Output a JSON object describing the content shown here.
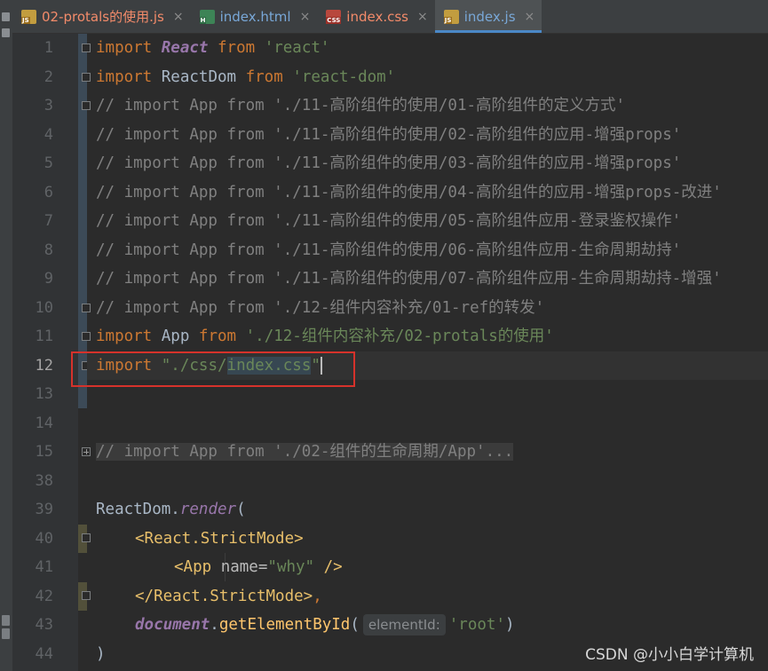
{
  "tabs": [
    {
      "label": "02-protals的使用.js",
      "icon": "js-file-icon",
      "state": "error"
    },
    {
      "label": "index.html",
      "icon": "html-file-icon",
      "state": "normal"
    },
    {
      "label": "index.css",
      "icon": "css-file-icon",
      "state": "error"
    },
    {
      "label": "index.js",
      "icon": "js-file-icon",
      "state": "active"
    }
  ],
  "tab_close_glyph": "×",
  "file_badges": {
    "js": "JS",
    "html": "H",
    "css": "CSS"
  },
  "line_numbers": [
    "1",
    "2",
    "3",
    "4",
    "5",
    "6",
    "7",
    "8",
    "9",
    "10",
    "11",
    "12",
    "13",
    "14",
    "15",
    "38",
    "39",
    "40",
    "41",
    "42",
    "43",
    "44"
  ],
  "current_line": "12",
  "code": {
    "l1": {
      "kw": "import",
      "name": "React",
      "from": "from",
      "path": "'react'"
    },
    "l2": {
      "kw": "import",
      "name": "ReactDom",
      "from": "from",
      "path": "'react-dom'"
    },
    "l3": "// import App from './11-高阶组件的使用/01-高阶组件的定义方式'",
    "l4": "// import App from './11-高阶组件的使用/02-高阶组件的应用-增强props'",
    "l5": "// import App from './11-高阶组件的使用/03-高阶组件的应用-增强props'",
    "l6": "// import App from './11-高阶组件的使用/04-高阶组件的应用-增强props-改进'",
    "l7": "// import App from './11-高阶组件的使用/05-高阶组件应用-登录鉴权操作'",
    "l8": "// import App from './11-高阶组件的使用/06-高阶组件应用-生命周期劫持'",
    "l9": "// import App from './11-高阶组件的使用/07-高阶组件应用-生命周期劫持-增强'",
    "l10": "// import App from './12-组件内容补充/01-ref的转发'",
    "l11": {
      "kw": "import",
      "name": "App",
      "from": "from",
      "path": "'./12-组件内容补充/02-protals的使用'"
    },
    "l12": {
      "kw": "import",
      "q1": "\"./css/",
      "sel": "index.css",
      "q2": "\""
    },
    "l15": "// import App from './02-组件的生命周期/App'...",
    "l39": {
      "obj": "ReactDom",
      "dot": ".",
      "method": "render",
      "paren": "("
    },
    "l40": {
      "open": "<React.StrictMode>"
    },
    "l41": {
      "open": "<App",
      "attr": "name",
      "eq": "=",
      "val": "\"why\"",
      "close": "/>"
    },
    "l42": {
      "close": "</React.StrictMode>",
      "comma": ","
    },
    "l43": {
      "obj": "document",
      "dot": ".",
      "method": "getElementById",
      "paren": "(",
      "hint": "elementId:",
      "arg": "'root'",
      "close": ")"
    },
    "l44": ")"
  },
  "watermark": "CSDN @小小白学计算机",
  "colors": {
    "keyword": "#cc7832",
    "string": "#6a8759",
    "comment": "#808080",
    "class": "#9876aa",
    "tag": "#e8bf6a",
    "annotation_box": "#d6322b",
    "active_tab_underline": "#4a88c7"
  }
}
